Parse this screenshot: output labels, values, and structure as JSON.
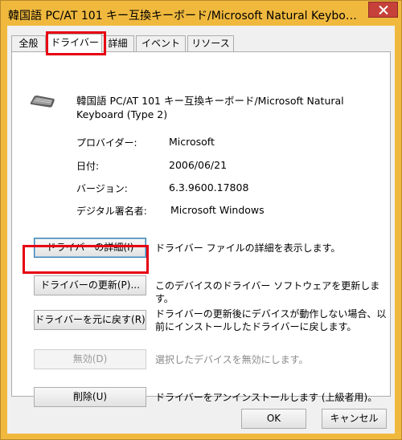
{
  "window": {
    "title": "韓国語 PC/AT 101 キー互換キーボード/Microsoft Natural Keybo…"
  },
  "tabs": [
    {
      "label": "全般",
      "active": false
    },
    {
      "label": "ドライバー",
      "active": true
    },
    {
      "label": "詳細",
      "active": false
    },
    {
      "label": "イベント",
      "active": false
    },
    {
      "label": "リソース",
      "active": false
    }
  ],
  "device": {
    "name": "韓国語 PC/AT 101 キー互換キーボード/Microsoft Natural Keyboard (Type 2)",
    "icon": "keyboard-icon"
  },
  "properties": [
    {
      "label": "プロバイダー:",
      "value": "Microsoft"
    },
    {
      "label": "日付:",
      "value": "2006/06/21"
    },
    {
      "label": "バージョン:",
      "value": "6.3.9600.17808"
    },
    {
      "label": "デジタル署名者:",
      "value": "Microsoft Windows"
    }
  ],
  "actions": [
    {
      "button": "ドライバーの詳細(I)",
      "description": "ドライバー ファイルの詳細を表示します。",
      "enabled": true
    },
    {
      "button": "ドライバーの更新(P)...",
      "description": "このデバイスのドライバー ソフトウェアを更新します。",
      "enabled": true
    },
    {
      "button": "ドライバーを元に戻す(R)",
      "description": "ドライバーの更新後にデバイスが動作しない場合、以前にインストールしたドライバーに戻します。",
      "enabled": true
    },
    {
      "button": "無効(D)",
      "description": "選択したデバイスを無効にします。",
      "enabled": false
    },
    {
      "button": "削除(U)",
      "description": "ドライバーをアンインストールします (上級者用)。",
      "enabled": true
    }
  ],
  "footer": {
    "ok_label": "OK",
    "cancel_label": "キャンセル"
  },
  "colors": {
    "title_bar": "#f0b93e",
    "close_button": "#c7413b",
    "highlight": "#e60012"
  }
}
